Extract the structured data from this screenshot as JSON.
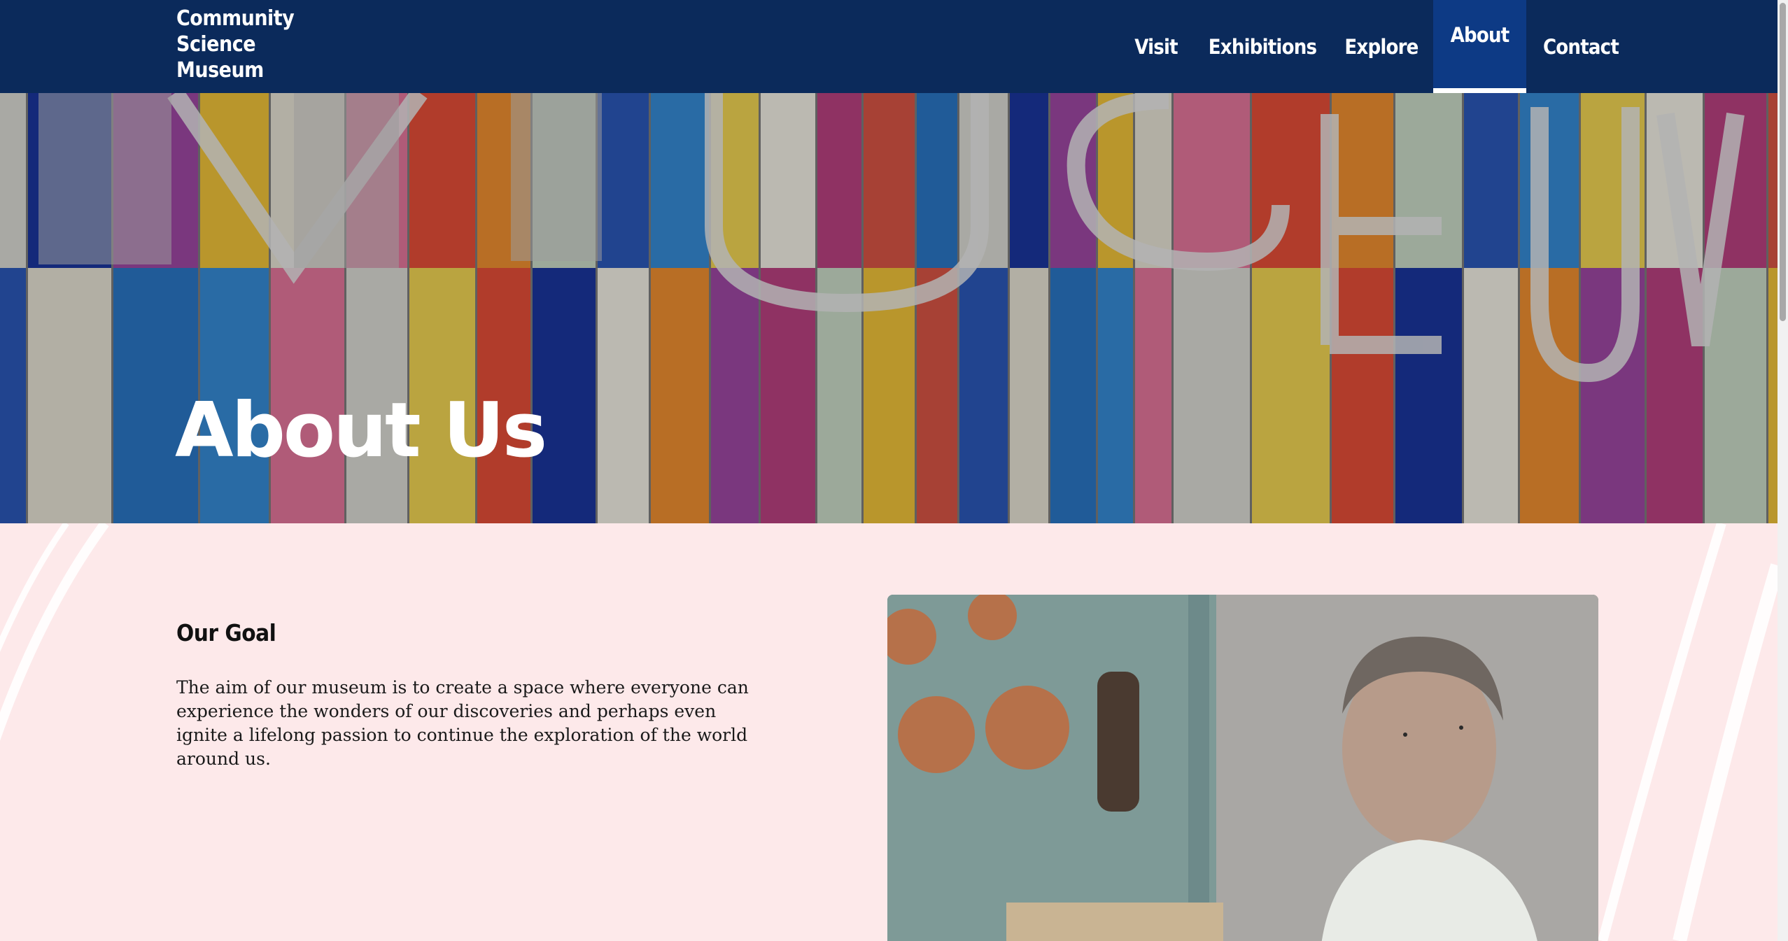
{
  "site": {
    "logo_lines": [
      "Community",
      "Science",
      "Museum"
    ]
  },
  "nav": {
    "items": [
      {
        "label": "Visit"
      },
      {
        "label": "Exhibitions"
      },
      {
        "label": "Explore"
      },
      {
        "label": "About",
        "active": true
      },
      {
        "label": "Contact"
      }
    ]
  },
  "hero": {
    "title": "About Us"
  },
  "goal": {
    "heading": "Our Goal",
    "text": "The aim of our museum is to create a space where everyone can experience the wonders of our discoveries and perhaps even ignite a lifelong passion to continue the exploration of the world around us."
  },
  "colors": {
    "header_bg": "#0b2a5b",
    "active_nav_bg": "#0d3a85",
    "page_bg": "#fde9ea"
  }
}
